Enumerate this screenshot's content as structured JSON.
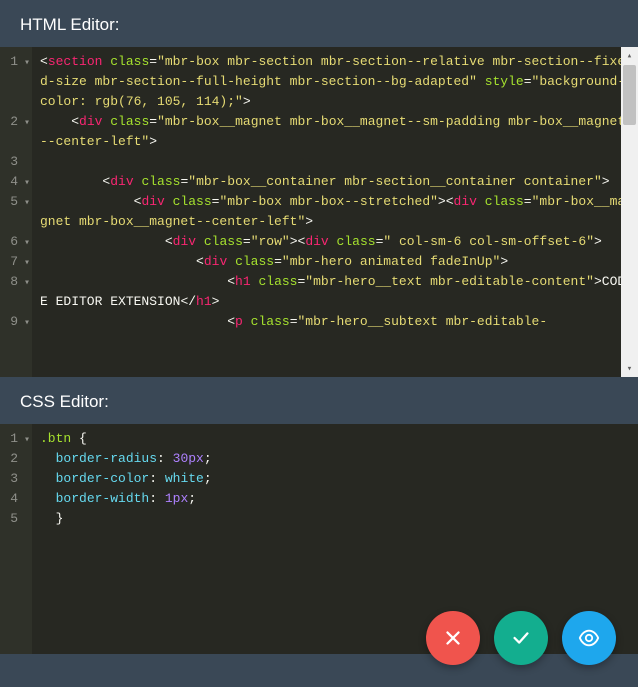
{
  "html_editor": {
    "title": "HTML Editor:",
    "lines": [
      {
        "n": 1,
        "fold": true,
        "tokens": [
          {
            "c": "tok-punc",
            "t": "<"
          },
          {
            "c": "tok-tag",
            "t": "section"
          },
          {
            "c": "",
            "t": " "
          },
          {
            "c": "tok-attr",
            "t": "class"
          },
          {
            "c": "tok-op",
            "t": "="
          },
          {
            "c": "tok-str",
            "t": "\"mbr-box mbr-section mbr-section--relative mbr-section--fixed-size mbr-section--full-height mbr-section--bg-adapted\""
          },
          {
            "c": "",
            "t": " "
          },
          {
            "c": "tok-attr",
            "t": "style"
          },
          {
            "c": "tok-op",
            "t": "="
          },
          {
            "c": "tok-str",
            "t": "\"background-color: rgb(76, 105, 114);\""
          },
          {
            "c": "tok-punc",
            "t": ">"
          }
        ]
      },
      {
        "n": 2,
        "fold": true,
        "tokens": [
          {
            "c": "",
            "t": "    "
          },
          {
            "c": "tok-punc",
            "t": "<"
          },
          {
            "c": "tok-tag",
            "t": "div"
          },
          {
            "c": "",
            "t": " "
          },
          {
            "c": "tok-attr",
            "t": "class"
          },
          {
            "c": "tok-op",
            "t": "="
          },
          {
            "c": "tok-str",
            "t": "\"mbr-box__magnet mbr-box__magnet--sm-padding mbr-box__magnet--center-left\""
          },
          {
            "c": "tok-punc",
            "t": ">"
          }
        ]
      },
      {
        "n": 3,
        "fold": false,
        "tokens": [
          {
            "c": "",
            "t": "        "
          }
        ]
      },
      {
        "n": 4,
        "fold": true,
        "tokens": [
          {
            "c": "",
            "t": "        "
          },
          {
            "c": "tok-punc",
            "t": "<"
          },
          {
            "c": "tok-tag",
            "t": "div"
          },
          {
            "c": "",
            "t": " "
          },
          {
            "c": "tok-attr",
            "t": "class"
          },
          {
            "c": "tok-op",
            "t": "="
          },
          {
            "c": "tok-str",
            "t": "\"mbr-box__container mbr-section__container container\""
          },
          {
            "c": "tok-punc",
            "t": ">"
          }
        ]
      },
      {
        "n": 5,
        "fold": true,
        "tokens": [
          {
            "c": "",
            "t": "            "
          },
          {
            "c": "tok-punc",
            "t": "<"
          },
          {
            "c": "tok-tag",
            "t": "div"
          },
          {
            "c": "",
            "t": " "
          },
          {
            "c": "tok-attr",
            "t": "class"
          },
          {
            "c": "tok-op",
            "t": "="
          },
          {
            "c": "tok-str",
            "t": "\"mbr-box mbr-box--stretched\""
          },
          {
            "c": "tok-punc",
            "t": ">"
          },
          {
            "c": "tok-punc",
            "t": "<"
          },
          {
            "c": "tok-tag",
            "t": "div"
          },
          {
            "c": "",
            "t": " "
          },
          {
            "c": "tok-attr",
            "t": "class"
          },
          {
            "c": "tok-op",
            "t": "="
          },
          {
            "c": "tok-str",
            "t": "\"mbr-box__magnet mbr-box__magnet--center-left\""
          },
          {
            "c": "tok-punc",
            "t": ">"
          }
        ]
      },
      {
        "n": 6,
        "fold": true,
        "tokens": [
          {
            "c": "",
            "t": "                "
          },
          {
            "c": "tok-punc",
            "t": "<"
          },
          {
            "c": "tok-tag",
            "t": "div"
          },
          {
            "c": "",
            "t": " "
          },
          {
            "c": "tok-attr",
            "t": "class"
          },
          {
            "c": "tok-op",
            "t": "="
          },
          {
            "c": "tok-str",
            "t": "\"row\""
          },
          {
            "c": "tok-punc",
            "t": ">"
          },
          {
            "c": "tok-punc",
            "t": "<"
          },
          {
            "c": "tok-tag",
            "t": "div"
          },
          {
            "c": "",
            "t": " "
          },
          {
            "c": "tok-attr",
            "t": "class"
          },
          {
            "c": "tok-op",
            "t": "="
          },
          {
            "c": "tok-str",
            "t": "\" col-sm-6 col-sm-offset-6\""
          },
          {
            "c": "tok-punc",
            "t": ">"
          }
        ]
      },
      {
        "n": 7,
        "fold": true,
        "tokens": [
          {
            "c": "",
            "t": "                    "
          },
          {
            "c": "tok-punc",
            "t": "<"
          },
          {
            "c": "tok-tag",
            "t": "div"
          },
          {
            "c": "",
            "t": " "
          },
          {
            "c": "tok-attr",
            "t": "class"
          },
          {
            "c": "tok-op",
            "t": "="
          },
          {
            "c": "tok-str",
            "t": "\"mbr-hero animated fadeInUp\""
          },
          {
            "c": "tok-punc",
            "t": ">"
          }
        ]
      },
      {
        "n": 8,
        "fold": true,
        "tokens": [
          {
            "c": "",
            "t": "                        "
          },
          {
            "c": "tok-punc",
            "t": "<"
          },
          {
            "c": "tok-tag",
            "t": "h1"
          },
          {
            "c": "",
            "t": " "
          },
          {
            "c": "tok-attr",
            "t": "class"
          },
          {
            "c": "tok-op",
            "t": "="
          },
          {
            "c": "tok-str",
            "t": "\"mbr-hero__text mbr-editable-content\""
          },
          {
            "c": "tok-punc",
            "t": ">"
          },
          {
            "c": "tok-text",
            "t": "CODE EDITOR EXTENSION"
          },
          {
            "c": "tok-punc",
            "t": "</"
          },
          {
            "c": "tok-tag",
            "t": "h1"
          },
          {
            "c": "tok-punc",
            "t": ">"
          }
        ]
      },
      {
        "n": 9,
        "fold": true,
        "tokens": [
          {
            "c": "",
            "t": "                        "
          },
          {
            "c": "tok-punc",
            "t": "<"
          },
          {
            "c": "tok-tag",
            "t": "p"
          },
          {
            "c": "",
            "t": " "
          },
          {
            "c": "tok-attr",
            "t": "class"
          },
          {
            "c": "tok-op",
            "t": "="
          },
          {
            "c": "tok-str",
            "t": "\"mbr-hero__subtext mbr-editable-"
          }
        ]
      }
    ]
  },
  "css_editor": {
    "title": "CSS Editor:",
    "lines": [
      {
        "n": 1,
        "fold": true,
        "tokens": [
          {
            "c": "tok-sel",
            "t": ".btn"
          },
          {
            "c": "",
            "t": " "
          },
          {
            "c": "tok-punc",
            "t": "{"
          }
        ]
      },
      {
        "n": 2,
        "fold": false,
        "tokens": [
          {
            "c": "",
            "t": "  "
          },
          {
            "c": "tok-prop",
            "t": "border-radius"
          },
          {
            "c": "tok-punc",
            "t": ": "
          },
          {
            "c": "tok-val",
            "t": "30px"
          },
          {
            "c": "tok-punc",
            "t": ";"
          }
        ]
      },
      {
        "n": 3,
        "fold": false,
        "tokens": [
          {
            "c": "",
            "t": "  "
          },
          {
            "c": "tok-prop",
            "t": "border-color"
          },
          {
            "c": "tok-punc",
            "t": ": "
          },
          {
            "c": "tok-valw",
            "t": "white"
          },
          {
            "c": "tok-punc",
            "t": ";"
          }
        ]
      },
      {
        "n": 4,
        "fold": false,
        "tokens": [
          {
            "c": "",
            "t": "  "
          },
          {
            "c": "tok-prop",
            "t": "border-width"
          },
          {
            "c": "tok-punc",
            "t": ": "
          },
          {
            "c": "tok-val",
            "t": "1px"
          },
          {
            "c": "tok-punc",
            "t": ";"
          }
        ]
      },
      {
        "n": 5,
        "fold": false,
        "tokens": [
          {
            "c": "",
            "t": "  "
          },
          {
            "c": "tok-punc",
            "t": "}"
          }
        ]
      }
    ]
  },
  "actions": {
    "cancel": "Cancel",
    "save": "Save",
    "preview": "Preview"
  }
}
